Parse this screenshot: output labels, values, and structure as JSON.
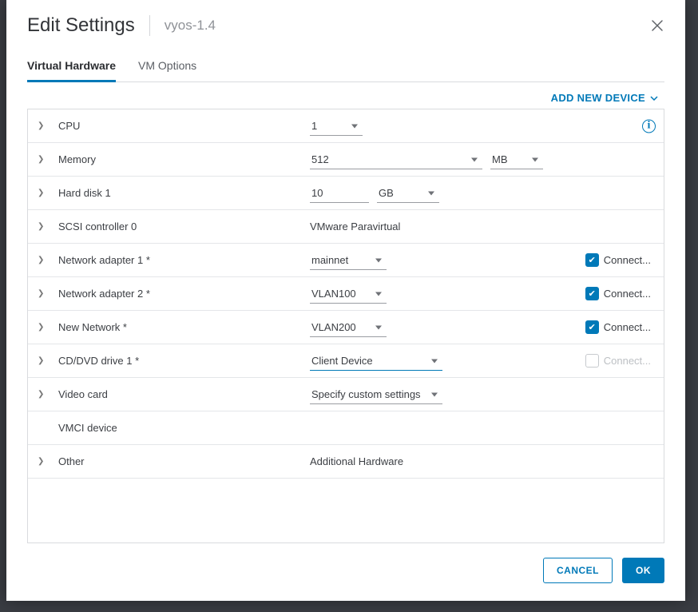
{
  "header": {
    "title": "Edit Settings",
    "subtitle": "vyos-1.4"
  },
  "tabs": {
    "hardware": "Virtual Hardware",
    "options": "VM Options"
  },
  "toolbar": {
    "add_device": "ADD NEW DEVICE"
  },
  "rows": {
    "cpu": {
      "label": "CPU",
      "value": "1"
    },
    "memory": {
      "label": "Memory",
      "value": "512",
      "unit": "MB"
    },
    "hdd": {
      "label": "Hard disk 1",
      "value": "10",
      "unit": "GB"
    },
    "scsi": {
      "label": "SCSI controller 0",
      "value": "VMware Paravirtual"
    },
    "net1": {
      "label": "Network adapter 1 *",
      "value": "mainnet",
      "connect": "Connect..."
    },
    "net2": {
      "label": "Network adapter 2 *",
      "value": "VLAN100",
      "connect": "Connect..."
    },
    "net3": {
      "label": "New Network *",
      "value": "VLAN200",
      "connect": "Connect..."
    },
    "cd": {
      "label": "CD/DVD drive 1 *",
      "value": "Client Device",
      "connect": "Connect..."
    },
    "video": {
      "label": "Video card",
      "value": "Specify custom settings"
    },
    "vmci": {
      "label": "VMCI device"
    },
    "other": {
      "label": "Other",
      "value": "Additional Hardware"
    }
  },
  "footer": {
    "cancel": "CANCEL",
    "ok": "OK"
  }
}
